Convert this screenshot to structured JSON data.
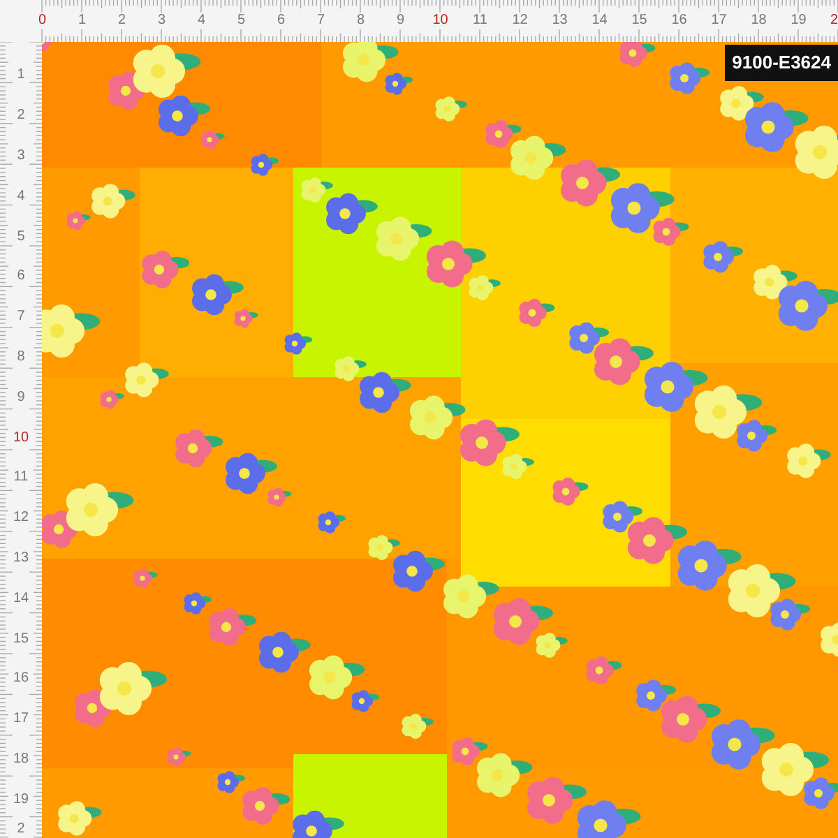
{
  "ruler_top": {
    "labels": [
      {
        "text": "0",
        "emphasized": true
      },
      {
        "text": "1",
        "emphasized": false
      },
      {
        "text": "2",
        "emphasized": false
      },
      {
        "text": "3",
        "emphasized": false
      },
      {
        "text": "4",
        "emphasized": false
      },
      {
        "text": "5",
        "emphasized": false
      },
      {
        "text": "6",
        "emphasized": false
      },
      {
        "text": "7",
        "emphasized": false
      },
      {
        "text": "8",
        "emphasized": false
      },
      {
        "text": "9",
        "emphasized": false
      },
      {
        "text": "10",
        "emphasized": true
      },
      {
        "text": "11",
        "emphasized": false
      },
      {
        "text": "12",
        "emphasized": false
      },
      {
        "text": "13",
        "emphasized": false
      },
      {
        "text": "14",
        "emphasized": false
      },
      {
        "text": "15",
        "emphasized": false
      },
      {
        "text": "16",
        "emphasized": false
      },
      {
        "text": "17",
        "emphasized": false
      },
      {
        "text": "18",
        "emphasized": false
      },
      {
        "text": "19",
        "emphasized": false
      },
      {
        "text": "2",
        "emphasized": true
      }
    ]
  },
  "ruler_left": {
    "labels": [
      {
        "text": "1",
        "emphasized": false
      },
      {
        "text": "2",
        "emphasized": false
      },
      {
        "text": "3",
        "emphasized": false
      },
      {
        "text": "4",
        "emphasized": false
      },
      {
        "text": "5",
        "emphasized": false
      },
      {
        "text": "6",
        "emphasized": false
      },
      {
        "text": "7",
        "emphasized": false
      },
      {
        "text": "8",
        "emphasized": false
      },
      {
        "text": "9",
        "emphasized": false
      },
      {
        "text": "10",
        "emphasized": true
      },
      {
        "text": "11",
        "emphasized": false
      },
      {
        "text": "12",
        "emphasized": false
      },
      {
        "text": "13",
        "emphasized": false
      },
      {
        "text": "14",
        "emphasized": false
      },
      {
        "text": "15",
        "emphasized": false
      },
      {
        "text": "16",
        "emphasized": false
      },
      {
        "text": "17",
        "emphasized": false
      },
      {
        "text": "18",
        "emphasized": false
      },
      {
        "text": "19",
        "emphasized": false
      },
      {
        "text": "2",
        "emphasized": false
      }
    ]
  },
  "pattern": {
    "code": "9100-E3624"
  }
}
